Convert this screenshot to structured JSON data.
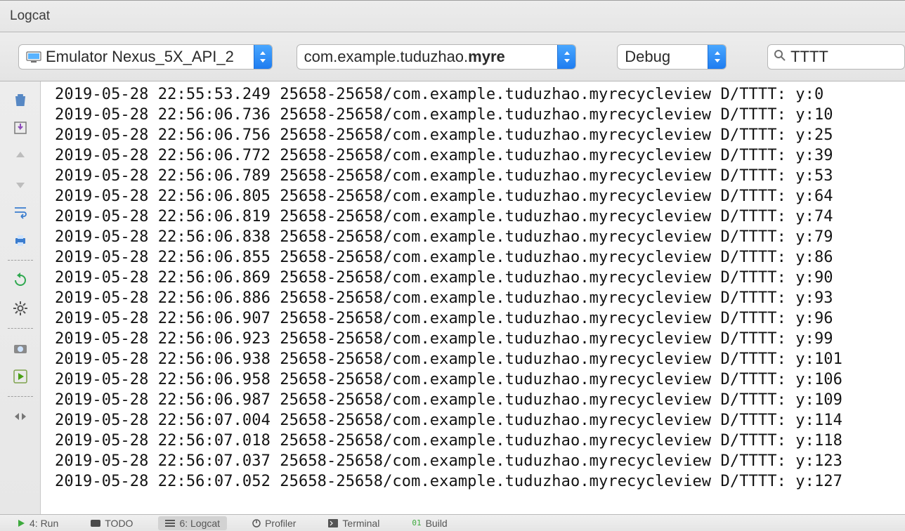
{
  "panel": {
    "title": "Logcat"
  },
  "toolbar": {
    "device_label": "Emulator Nexus_5X_API_2",
    "process_prefix": "com.example.tuduzhao.",
    "process_bold": "myre",
    "level_label": "Debug",
    "search_value": "TTTT"
  },
  "gutter_icons": [
    {
      "name": "trash-icon"
    },
    {
      "name": "import-icon"
    },
    {
      "name": "arrow-up-icon"
    },
    {
      "name": "arrow-down-icon"
    },
    {
      "name": "wrap-icon"
    },
    {
      "name": "print-icon"
    },
    {
      "name": "restart-icon"
    },
    {
      "name": "gear-icon"
    },
    {
      "name": "camera-icon"
    },
    {
      "name": "play-icon"
    },
    {
      "name": "expand-icon"
    }
  ],
  "log": {
    "pid_tid": "25658-25658",
    "package": "com.example.tuduzhao.myrecycleview",
    "level": "D",
    "tag": "TTTT",
    "entries": [
      {
        "ts": "2019-05-28 22:55:53.249",
        "msg": "y:0"
      },
      {
        "ts": "2019-05-28 22:56:06.736",
        "msg": "y:10"
      },
      {
        "ts": "2019-05-28 22:56:06.756",
        "msg": "y:25"
      },
      {
        "ts": "2019-05-28 22:56:06.772",
        "msg": "y:39"
      },
      {
        "ts": "2019-05-28 22:56:06.789",
        "msg": "y:53"
      },
      {
        "ts": "2019-05-28 22:56:06.805",
        "msg": "y:64"
      },
      {
        "ts": "2019-05-28 22:56:06.819",
        "msg": "y:74"
      },
      {
        "ts": "2019-05-28 22:56:06.838",
        "msg": "y:79"
      },
      {
        "ts": "2019-05-28 22:56:06.855",
        "msg": "y:86"
      },
      {
        "ts": "2019-05-28 22:56:06.869",
        "msg": "y:90"
      },
      {
        "ts": "2019-05-28 22:56:06.886",
        "msg": "y:93"
      },
      {
        "ts": "2019-05-28 22:56:06.907",
        "msg": "y:96"
      },
      {
        "ts": "2019-05-28 22:56:06.923",
        "msg": "y:99"
      },
      {
        "ts": "2019-05-28 22:56:06.938",
        "msg": "y:101"
      },
      {
        "ts": "2019-05-28 22:56:06.958",
        "msg": "y:106"
      },
      {
        "ts": "2019-05-28 22:56:06.987",
        "msg": "y:109"
      },
      {
        "ts": "2019-05-28 22:56:07.004",
        "msg": "y:114"
      },
      {
        "ts": "2019-05-28 22:56:07.018",
        "msg": "y:118"
      },
      {
        "ts": "2019-05-28 22:56:07.037",
        "msg": "y:123"
      },
      {
        "ts": "2019-05-28 22:56:07.052",
        "msg": "y:127"
      }
    ]
  },
  "bottom_tabs": {
    "run": "4: Run",
    "todo": "TODO",
    "logcat": "6: Logcat",
    "profiler": "Profiler",
    "terminal": "Terminal",
    "build": "Build"
  }
}
